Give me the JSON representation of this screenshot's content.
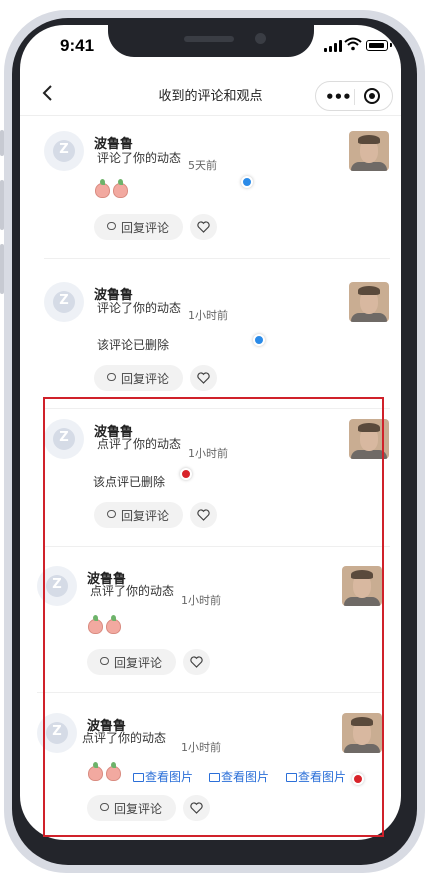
{
  "status_bar": {
    "time": "9:41"
  },
  "nav": {
    "title": "收到的评论和观点"
  },
  "reply_label": "回复评论",
  "items": [
    {
      "user": "波鲁鲁",
      "action": "评论了你的动态",
      "time": "5天前",
      "deleted": "",
      "has_emoji": true
    },
    {
      "user": "波鲁鲁",
      "action": "评论了你的动态",
      "time": "1小时前",
      "deleted": "该评论已删除",
      "has_emoji": false
    },
    {
      "user": "波鲁鲁",
      "action": "点评了你的动态",
      "time": "1小时前",
      "deleted": "该点评已删除",
      "has_emoji": false
    },
    {
      "user": "波鲁鲁",
      "action": "点评了你的动态",
      "time": "1小时前",
      "deleted": "",
      "has_emoji": true
    },
    {
      "user": "波鲁鲁",
      "action": "点评了你的动态",
      "time": "1小时前",
      "deleted": "",
      "has_emoji": true,
      "view_image_labels": [
        "查看图片",
        "查看图片",
        "查看图片"
      ]
    }
  ],
  "colors": {
    "accent_blue": "#2b8be8",
    "highlight_red": "#d0212a",
    "link_blue": "#2b6fd8"
  },
  "icons": [
    "back-icon",
    "more-icon",
    "target-icon",
    "comment-icon",
    "heart-icon",
    "image-icon"
  ]
}
